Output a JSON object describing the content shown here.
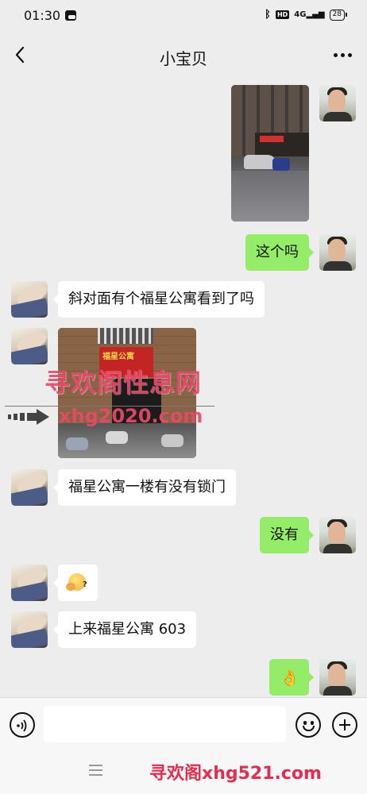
{
  "status_bar": {
    "time": "01:30",
    "network": "4G",
    "hd": "HD",
    "battery": "28"
  },
  "header": {
    "title": "小宝贝"
  },
  "messages": [
    {
      "sender": "me",
      "type": "image",
      "description_label": ""
    },
    {
      "sender": "me",
      "type": "text",
      "text": "这个吗"
    },
    {
      "sender": "contact",
      "type": "text",
      "text": "斜对面有个福星公寓看到了吗"
    },
    {
      "sender": "contact",
      "type": "image",
      "image_text": "福星公寓"
    },
    {
      "sender": "contact",
      "type": "text",
      "text": "福星公寓一楼有没有锁门"
    },
    {
      "sender": "me",
      "type": "text",
      "text": "没有"
    },
    {
      "sender": "contact",
      "type": "sticker",
      "icon": "thinking-face-icon"
    },
    {
      "sender": "contact",
      "type": "text",
      "text": "上来福星公寓 603"
    },
    {
      "sender": "me",
      "type": "sticker",
      "icon": "ok-hand-icon",
      "glyph": "👌"
    }
  ],
  "watermark": {
    "line1": "寻欢阁性息网",
    "line2": "xhg2020.com",
    "bottom": "寻欢阁xhg521.com"
  },
  "input": {
    "placeholder": ""
  },
  "colors": {
    "background": "#ededed",
    "bubble_out": "#95ec69",
    "bubble_in": "#ffffff",
    "watermark": "#e84a6a"
  }
}
